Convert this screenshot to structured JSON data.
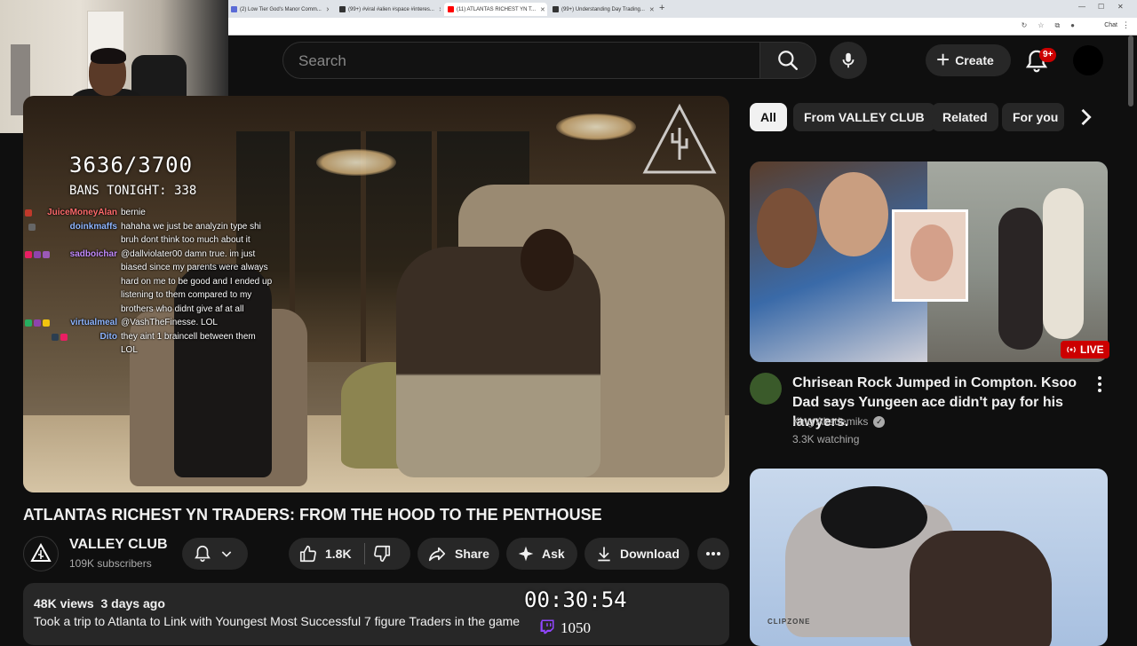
{
  "browser": {
    "tabs": [
      {
        "label": "(2) Low Tier God's Manor Comm...",
        "icon_color": "#5b6bd6"
      },
      {
        "label": "(99+) #viral #alien #space #interes...",
        "icon_color": "#111111"
      },
      {
        "label": "(11) ATLANTAS RICHEST YN T...",
        "icon_color": "#ff0000"
      },
      {
        "label": "(99+) Understanding Day Trading...",
        "icon_color": "#111111"
      }
    ],
    "new_tab": "+",
    "chat_label": "Chat"
  },
  "header": {
    "search_placeholder": "Search",
    "create_label": "Create",
    "notification_count": "9+"
  },
  "stream_overlay": {
    "count": "3636/3700",
    "bans": "BANS TONIGHT: 338",
    "timer": "00:30:54",
    "viewer_count": "1050"
  },
  "chat": [
    {
      "user": "JuiceMoneyAlan",
      "text": "bernie",
      "color": "#ff6b6b",
      "icons": [
        "#c0392b"
      ]
    },
    {
      "user": "doinkmaffs",
      "text": "hahaha we just be analyzin type shi",
      "color": "#8fb6ff",
      "icons": [
        "#666666"
      ]
    },
    {
      "user": "",
      "text": "bruh dont think too much about it",
      "color": "#8fb6ff",
      "icons": []
    },
    {
      "user": "sadboichar",
      "text": "@dallviolater00 damn true. im just",
      "color": "#c48cff",
      "icons": [
        "#e91e63",
        "#8e44ad",
        "#9b59b6"
      ]
    },
    {
      "user": "",
      "text": "biased since my parents were always",
      "color": "#8fb6ff",
      "icons": []
    },
    {
      "user": "",
      "text": "hard on me to be good and I ended up",
      "color": "#8fb6ff",
      "icons": []
    },
    {
      "user": "",
      "text": "listening to them compared to my",
      "color": "#8fb6ff",
      "icons": []
    },
    {
      "user": "",
      "text": "brothers who didnt give af at all",
      "color": "#8fb6ff",
      "icons": []
    },
    {
      "user": "virtualmeal",
      "text": "@VashTheFinesse. LOL",
      "color": "#8fb6ff",
      "icons": [
        "#27ae60",
        "#8e44ad",
        "#f1c40f"
      ]
    },
    {
      "user": "Dito",
      "text": "they aint 1 braincell between them",
      "color": "#8fb6ff",
      "icons": [
        "#2c3e50",
        "#e91e63"
      ]
    },
    {
      "user": "",
      "text": "LOL",
      "color": "#8fb6ff",
      "icons": []
    }
  ],
  "video": {
    "title": "ATLANTAS RICHEST YN TRADERS: FROM THE HOOD TO THE PENTHOUSE",
    "channel": "VALLEY CLUB",
    "subscribers": "109K subscribers",
    "logo_text": "VALLEY CLUB",
    "likes": "1.8K",
    "share_label": "Share",
    "ask_label": "Ask",
    "download_label": "Download",
    "views": "48K views",
    "age": "3 days ago",
    "description": "Took a trip to Atlanta to Link with Youngest Most Successful 7 figure Traders in the game"
  },
  "chips": [
    "All",
    "From VALLEY CLUB",
    "Related",
    "For you"
  ],
  "recommendations": [
    {
      "title": "Chrisean Rock Jumped in Compton. Ksoo Dad says Yungeen ace didn't pay for his lawyers.",
      "channel": "King Akademiks",
      "meta": "3.3K watching",
      "badge": "LIVE"
    },
    {
      "brand": "CLIPZONE"
    }
  ],
  "colors": {
    "background": "#0f0f0f",
    "pill": "#272727",
    "live": "#cc0000",
    "text_secondary": "#aaaaaa"
  }
}
